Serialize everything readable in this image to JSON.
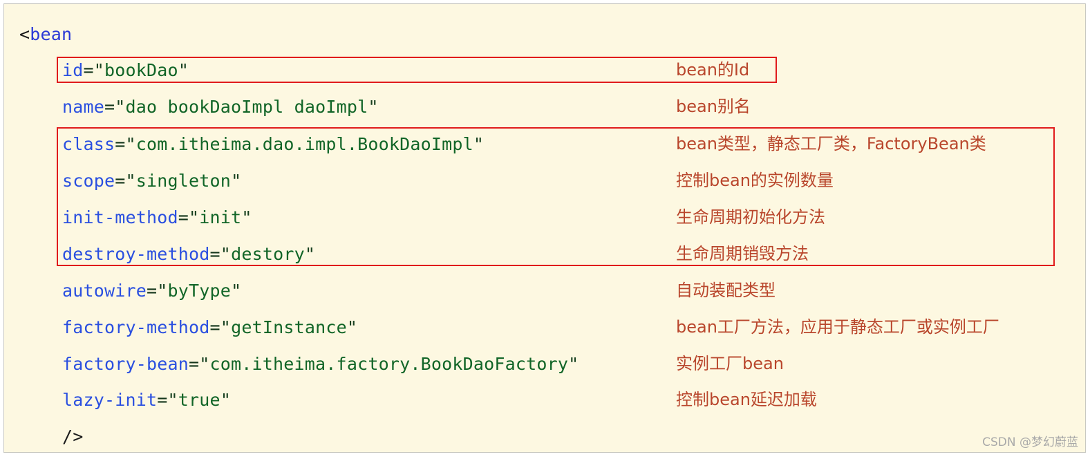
{
  "card": {
    "background_color": "#FDF8E1",
    "border_color": "#c9c9c1"
  },
  "colors": {
    "tag": "#2a39d6",
    "attribute": "#2a4fe0",
    "value": "#116527",
    "punctuation": "#1b1b1b",
    "annotation": "#b9462c",
    "highlight_box": "#e01b1b"
  },
  "code": {
    "open_tag": {
      "punct": "<",
      "tag": "bean"
    },
    "close_tag": "/>",
    "attributes": [
      {
        "name": "id",
        "eq": "=",
        "quote": "\"",
        "value": "bookDao"
      },
      {
        "name": "name",
        "eq": "=",
        "quote": "\"",
        "value": "dao bookDaoImpl daoImpl"
      },
      {
        "name": "class",
        "eq": "=",
        "quote": "\"",
        "value": "com.itheima.dao.impl.BookDaoImpl"
      },
      {
        "name": "scope",
        "eq": "=",
        "quote": "\"",
        "value": "singleton"
      },
      {
        "name": "init-method",
        "eq": "=",
        "quote": "\"",
        "value": "init"
      },
      {
        "name": "destroy-method",
        "eq": "=",
        "quote": "\"",
        "value": "destory"
      },
      {
        "name": "autowire",
        "eq": "=",
        "quote": "\"",
        "value": "byType"
      },
      {
        "name": "factory-method",
        "eq": "=",
        "quote": "\"",
        "value": "getInstance"
      },
      {
        "name": "factory-bean",
        "eq": "=",
        "quote": "\"",
        "value": "com.itheima.factory.BookDaoFactory"
      },
      {
        "name": "lazy-init",
        "eq": "=",
        "quote": "\"",
        "value": "true"
      }
    ]
  },
  "annotations": [
    "bean的Id",
    "bean别名",
    "bean类型，静态工厂类，FactoryBean类",
    "控制bean的实例数量",
    "生命周期初始化方法",
    "生命周期销毁方法",
    "自动装配类型",
    "bean工厂方法，应用于静态工厂或实例工厂",
    "实例工厂bean",
    "控制bean延迟加载"
  ],
  "watermark": "CSDN @梦幻蔚蓝"
}
